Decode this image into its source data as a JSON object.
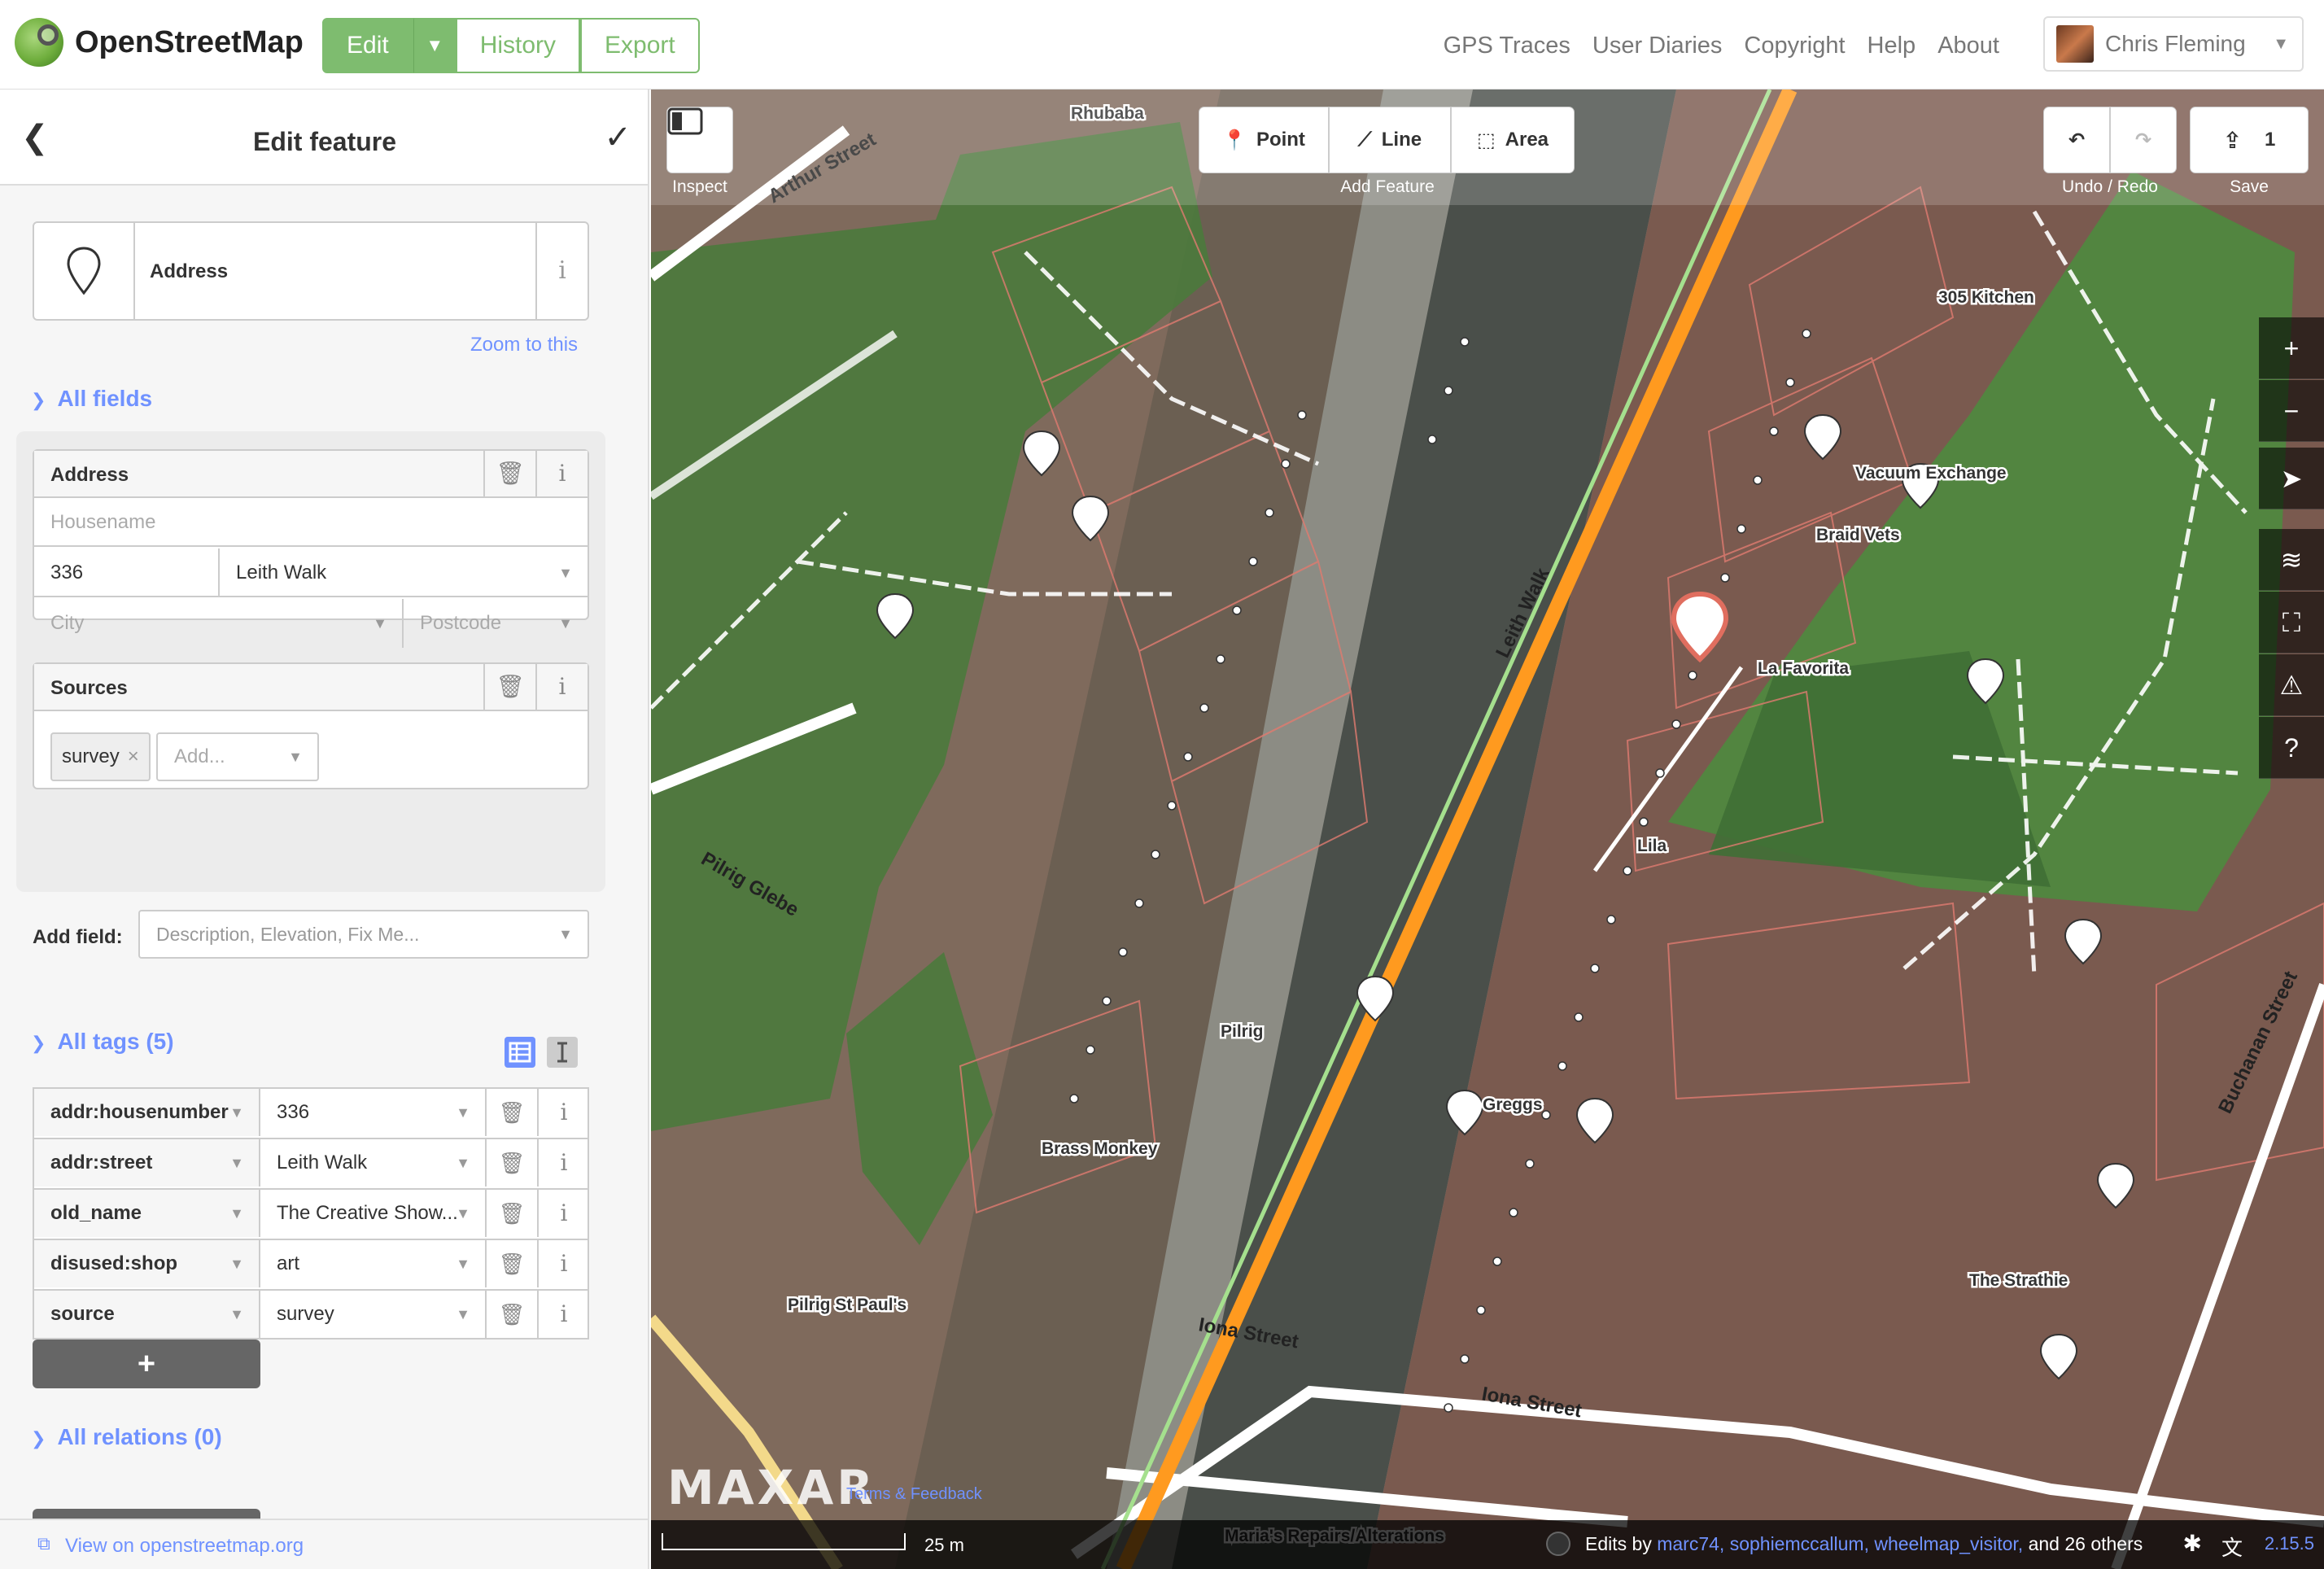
{
  "app": {
    "logo_text": "OpenStreetMap",
    "edit_label": "Edit",
    "history_label": "History",
    "export_label": "Export",
    "nav_links": [
      "GPS Traces",
      "User Diaries",
      "Copyright",
      "Help",
      "About"
    ],
    "user_name": "Chris Fleming"
  },
  "sidebar": {
    "title": "Edit feature",
    "preset_name": "Address",
    "preset_icon": "map-pin-icon",
    "zoom_to": "Zoom to this",
    "all_fields": "All fields",
    "address": {
      "label": "Address",
      "housename_placeholder": "Housename",
      "housenumber": "336",
      "street": "Leith Walk",
      "city_placeholder": "City",
      "postcode_placeholder": "Postcode"
    },
    "sources": {
      "label": "Sources",
      "chip": "survey",
      "add_placeholder": "Add..."
    },
    "add_field_label": "Add field:",
    "add_field_placeholder": "Description, Elevation, Fix Me...",
    "all_tags": "All tags (5)",
    "tags": [
      {
        "key": "addr:housenumber",
        "value": "336"
      },
      {
        "key": "addr:street",
        "value": "Leith Walk"
      },
      {
        "key": "old_name",
        "value": "The Creative Show..."
      },
      {
        "key": "disused:shop",
        "value": "art"
      },
      {
        "key": "source",
        "value": "survey"
      }
    ],
    "add_tag_label": "+",
    "all_relations": "All relations (0)",
    "add_relation_label": "+",
    "view_on_osm": "View on openstreetmap.org"
  },
  "map": {
    "toolbar": {
      "inspect": "Inspect",
      "point": "Point",
      "line": "Line",
      "area": "Area",
      "add_feature": "Add Feature",
      "undo_redo": "Undo / Redo",
      "save": "Save",
      "save_count": "1"
    },
    "street_labels": [
      "Arthur Street",
      "Leith Walk",
      "Pilrig Glebe",
      "Iona Street",
      "Iona Street",
      "Buchanan Street"
    ],
    "poi_labels": [
      "Rhubaba",
      "305 Kitchen",
      "Vacuum Exchange",
      "Braid Vets",
      "La Favorita",
      "Lila",
      "Pilrig",
      "Greggs",
      "Brass Monkey",
      "Pilrig St Paul's",
      "The Strathie",
      "Maria's Repairs/Alterations"
    ],
    "imagery_name": "MAXAR",
    "terms": "Terms & Feedback",
    "scale": "25 m",
    "footer": {
      "edits_by": "Edits by",
      "users": "marc74, sophiemccallum, wheelmap_visitor,",
      "and_others": "and 26 others",
      "version": "2.15.5"
    },
    "accent_color": "#7ebc6f",
    "selection_color": "#e06e5f"
  }
}
